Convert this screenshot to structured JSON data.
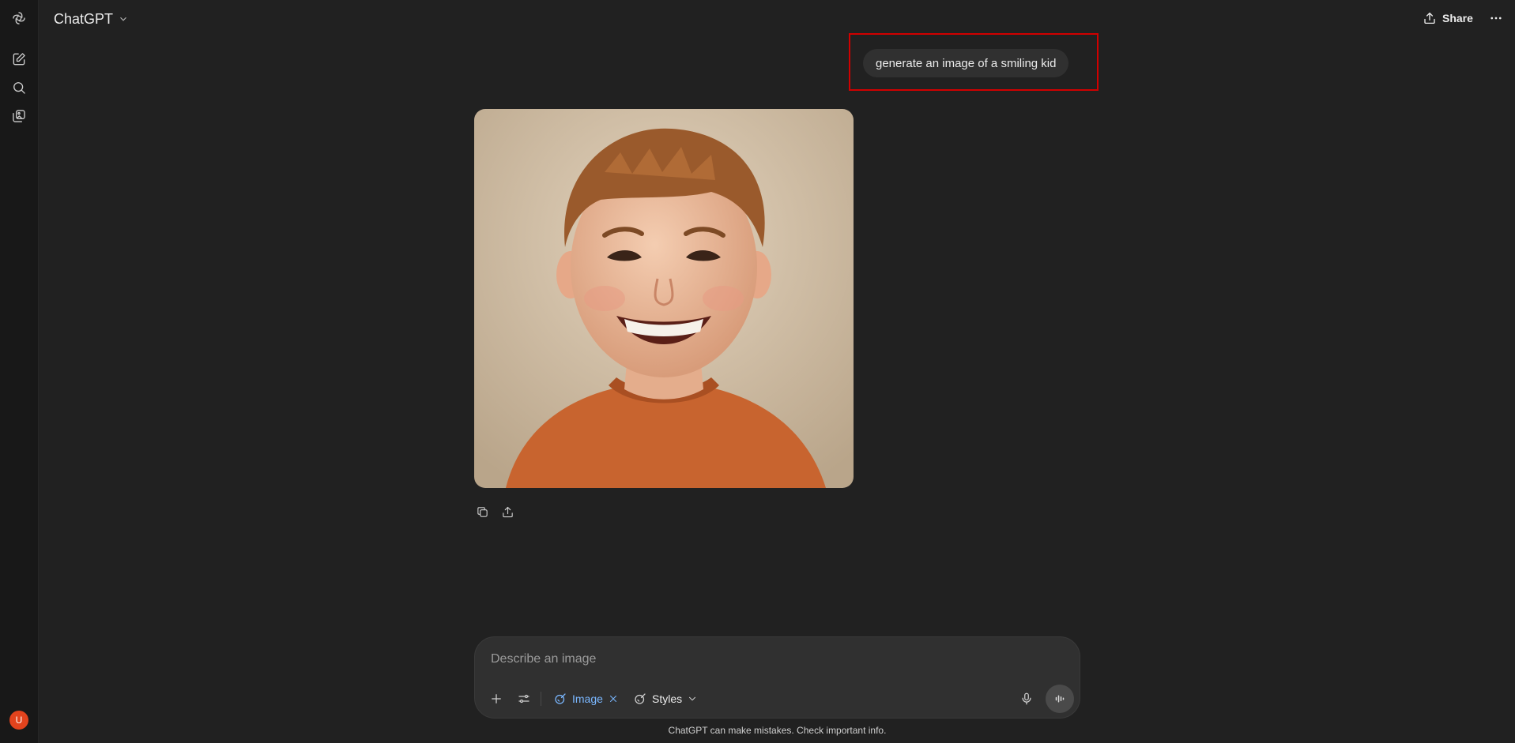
{
  "app": {
    "title": "ChatGPT"
  },
  "header": {
    "share_label": "Share"
  },
  "sidebar": {
    "icons": [
      "openai-logo-icon",
      "new-chat-icon",
      "search-icon",
      "library-icon"
    ],
    "avatar_initial": "U",
    "avatar_color": "#e3431d"
  },
  "conversation": {
    "user_message": "generate an image of a smiling kid",
    "highlight_color": "#d10000",
    "image_alt": "generated image of a smiling kid"
  },
  "composer": {
    "placeholder": "Describe an image",
    "image_chip_label": "Image",
    "styles_label": "Styles"
  },
  "footer": {
    "disclaimer": "ChatGPT can make mistakes. Check important info."
  }
}
